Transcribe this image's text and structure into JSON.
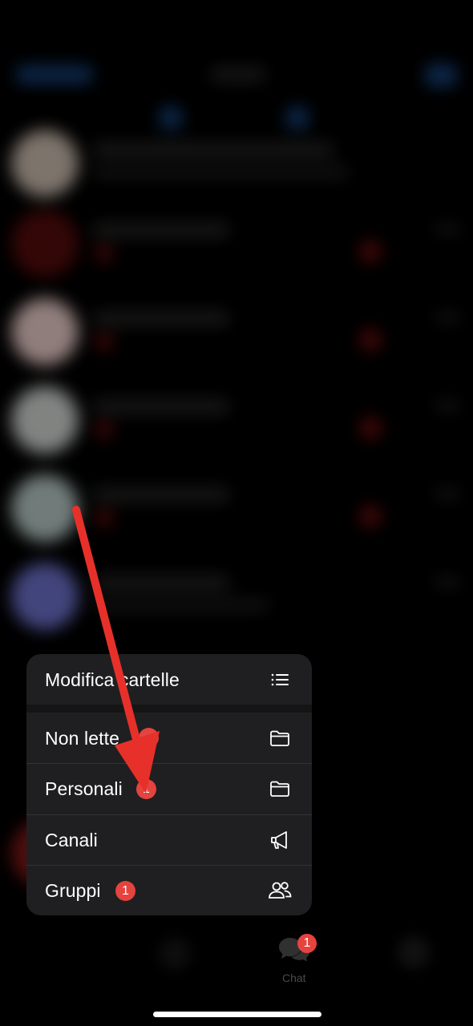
{
  "colors": {
    "menu_bg": "#1f1f21",
    "badge": "#e5433d",
    "annotation_arrow": "#e8302a",
    "background": "#000000"
  },
  "menu": {
    "items": [
      {
        "label": "Modifica cartelle",
        "icon": "list-icon"
      },
      {
        "label": "Non lette",
        "icon": "folder-icon"
      },
      {
        "label": "Personali",
        "badge": "1",
        "icon": "folder-icon"
      },
      {
        "label": "Canali",
        "icon": "megaphone-icon"
      },
      {
        "label": "Gruppi",
        "badge": "1",
        "icon": "people-icon"
      }
    ]
  },
  "tabbar": {
    "chat": {
      "label": "Chat",
      "badge": "1",
      "icon": "chat-bubbles-icon"
    }
  }
}
